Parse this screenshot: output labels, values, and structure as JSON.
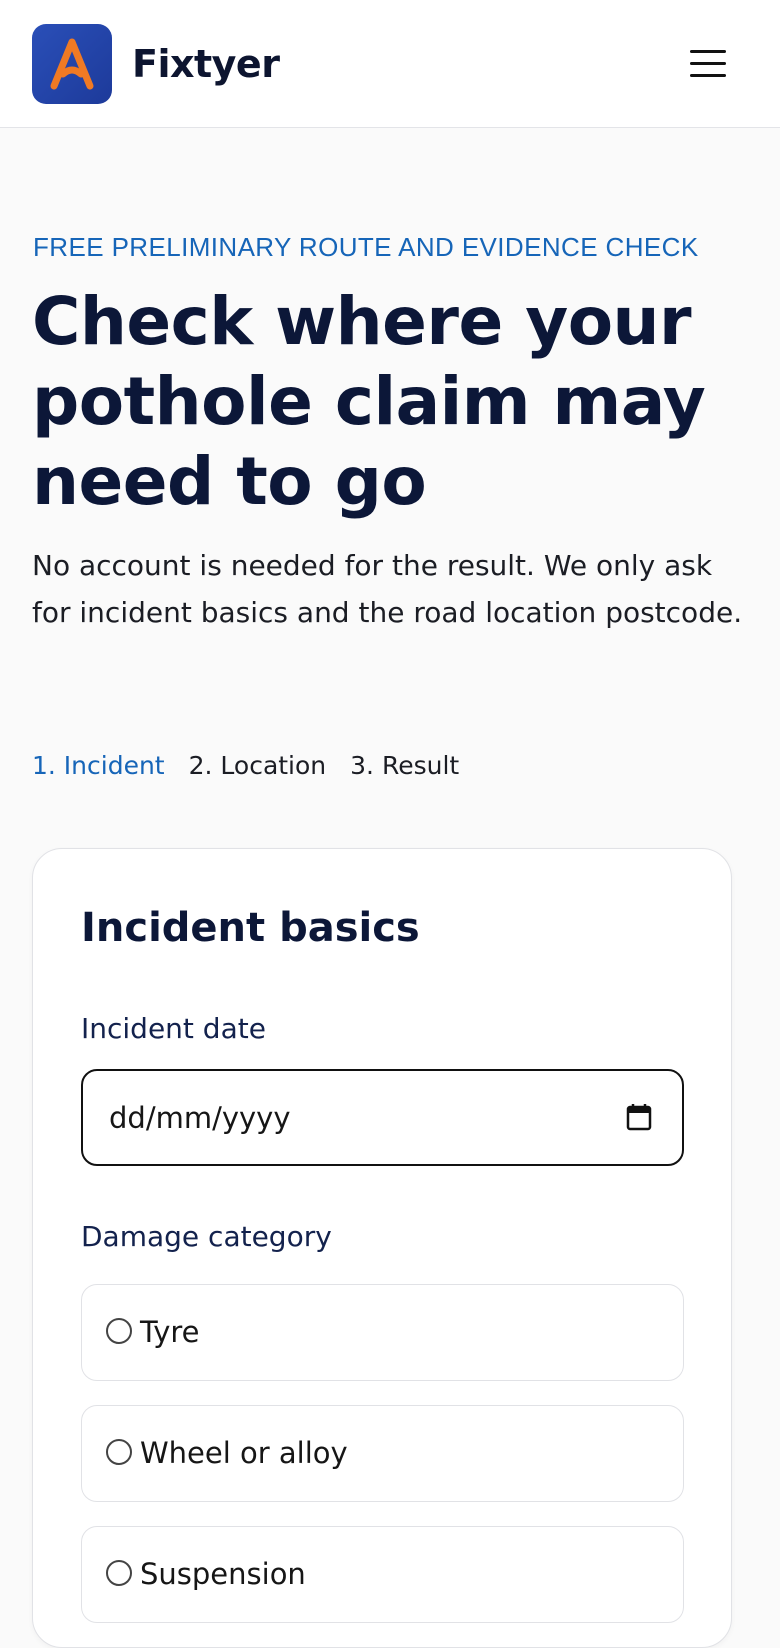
{
  "header": {
    "brand": "Fixtyer",
    "logo_icon": "a-letter-logo-icon",
    "menu_icon": "hamburger-menu-icon"
  },
  "hero": {
    "eyebrow": "FREE PRELIMINARY ROUTE AND EVIDENCE CHECK",
    "title": "Check where your pothole claim may need to go",
    "lead": "No account is needed for the result. We only ask for incident basics and the road location postcode."
  },
  "steps": [
    {
      "label": "1. Incident",
      "active": true
    },
    {
      "label": "2. Location",
      "active": false
    },
    {
      "label": "3. Result",
      "active": false
    }
  ],
  "form": {
    "title": "Incident basics",
    "date_label": "Incident date",
    "date_placeholder": "dd/mm/yyyy",
    "date_icon": "calendar-icon",
    "damage_label": "Damage category",
    "damage_options": [
      {
        "label": "Tyre"
      },
      {
        "label": "Wheel or alloy"
      },
      {
        "label": "Suspension"
      }
    ]
  },
  "colors": {
    "accent": "#1665b8",
    "navy": "#0c1738",
    "logo_bg": "#2a4fb8",
    "logo_mark": "#f07a24"
  }
}
